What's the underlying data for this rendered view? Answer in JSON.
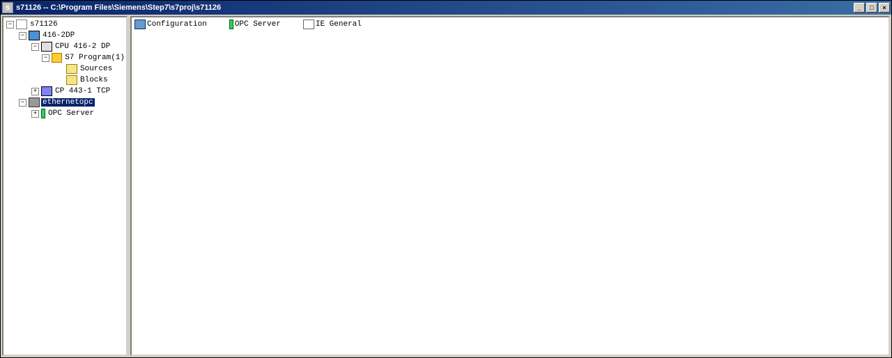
{
  "window": {
    "title": "s71126 -- C:\\Program Files\\Siemens\\Step7\\s7proj\\s71126",
    "minimize_label": "_",
    "maximize_label": "□",
    "close_label": "×"
  },
  "tree": {
    "n0": {
      "label": "s71126",
      "exp": "−"
    },
    "n1": {
      "label": "416-2DP",
      "exp": "−"
    },
    "n2": {
      "label": "CPU 416-2 DP",
      "exp": "−"
    },
    "n3": {
      "label": "S7 Program(1)",
      "exp": "−"
    },
    "n4": {
      "label": "Sources"
    },
    "n5": {
      "label": "Blocks"
    },
    "n6": {
      "label": "CP 443-1 TCP",
      "exp": "+"
    },
    "n7": {
      "label": "ethernetopc",
      "exp": "−",
      "selected": true
    },
    "n8": {
      "label": "OPC Server",
      "exp": "+"
    }
  },
  "content": {
    "items": [
      {
        "label": "Configuration",
        "icon": "config"
      },
      {
        "label": "OPC Server",
        "icon": "opc"
      },
      {
        "label": "IE General",
        "icon": "iegen"
      }
    ]
  }
}
